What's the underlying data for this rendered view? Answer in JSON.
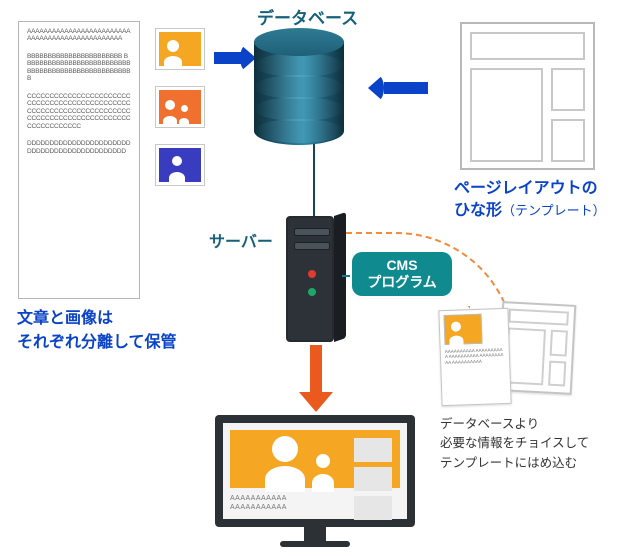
{
  "labels": {
    "database": "データベース",
    "server": "サーバー",
    "template_l1": "ページレイアウトの",
    "template_l2a": "ひな形",
    "template_l2b": "（テンプレート）",
    "separate_l1": "文章と画像は",
    "separate_l2": "それぞれ分離して保管",
    "cms_l1": "CMS",
    "cms_l2": "プログラム",
    "assemble_l1": "データベースより",
    "assemble_l2": "必要な情報をチョイスして",
    "assemble_l3": "テンプレートにはめ込む"
  },
  "doc_text": {
    "a": "AAAAAAAAAAAAAAAAAAAAAAAAAAAAAAAAAAAAAAAAAAAAAAAA",
    "b": "BBBBBBBBBBBBBBBBBBBBBBB BBBBBBBBBBBBBBBBBBBBBBBBBBBBBBBBBBBBBBBBBBBBBBBBBBBB",
    "c": "CCCCCCCCCCCCCCCCCCCCCCC CCCCCCCCCCCCCCCCCCCCCCCCCCCCCCCCCCCCCCCCCCCCCCCCCCCCCCCCCCCCCCCCCCCCCCCCCCCCCCCCC",
    "d": "DDDDDDDDDDDDDDDDDDDDDDDDDDDDDDDDDDDDDDDDDDDDD"
  },
  "assy_text": "AAAAAAAAAA AAAAAAAAAA AAAAAAAAAA AAAAAAAAAA AAAAAAAAAA",
  "monitor_text": "AAAAAAAAAAA\nAAAAAAAAAAA",
  "colors": {
    "accent_blue": "#0a42c8",
    "db_teal": "#1c5268",
    "cms_badge": "#0f8a8f",
    "arrow_orange": "#ea5a1f",
    "dash_orange": "#f28b3c",
    "photo_orange": "#f5a623"
  }
}
